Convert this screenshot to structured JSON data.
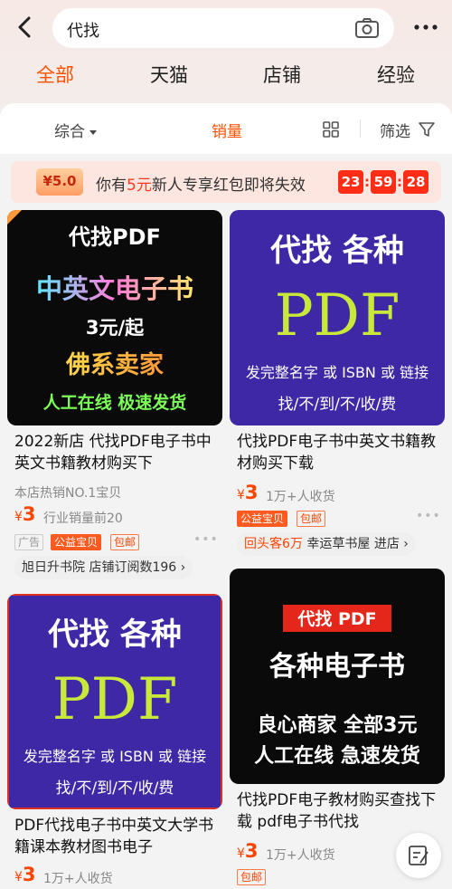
{
  "search": {
    "query": "代找"
  },
  "tabs": [
    "全部",
    "天猫",
    "店铺",
    "经验"
  ],
  "filters": {
    "sort": "综合",
    "sales": "销量",
    "filter": "筛选"
  },
  "promo": {
    "coupon": "¥5.0",
    "text_pre": "你有",
    "amount": "5元",
    "text_post": "新人专享红包即将失效",
    "hh": "23",
    "mm": "59",
    "ss": "28"
  },
  "products": [
    {
      "image": {
        "lines": [
          "代找PDF",
          "中英文电子书",
          "3元/起",
          "佛系卖家",
          "人工在线  极速发货"
        ]
      },
      "title": "2022新店 代找PDF电子书中英文书籍教材购买下",
      "subtitle": "本店热销NO.1宝贝",
      "price_symbol": "¥",
      "price": "3",
      "sales": "行业销量前20",
      "tags": [
        "广告",
        "公益宝贝",
        "包邮"
      ],
      "shop": "旭日升书院 店铺订阅数196"
    },
    {
      "image": {
        "lines": [
          "代找  各种",
          "PDF",
          "发完整名字 或 ISBN 或 链接",
          "找/不/到/不/收/费"
        ]
      },
      "title": "代找PDF电子书中英文书籍教材购买下载",
      "price_symbol": "¥",
      "price": "3",
      "sales": "1万+人收货",
      "tags": [
        "公益宝贝",
        "包邮"
      ],
      "shop_highlight": "回头客6万",
      "shop_name": "幸运草书屋",
      "shop_enter": "进店"
    },
    {
      "image": {
        "lines": [
          "代找  各种",
          "PDF",
          "发完整名字 或 ISBN 或 链接",
          "找/不/到/不/收/费"
        ]
      },
      "title": "PDF代找电子书中英文大学书籍课本教材图书电子",
      "price_symbol": "¥",
      "price": "3",
      "sales": "1万+人收货"
    },
    {
      "image": {
        "lines": [
          "代找 PDF",
          "各种电子书",
          "良心商家  全部3元",
          "人工在线  急速发货"
        ]
      },
      "title": "代找PDF电子教材购买查找下载 pdf电子书代找",
      "price_symbol": "¥",
      "price": "3",
      "sales": "1万+人收货",
      "tags": [
        "包邮"
      ]
    }
  ],
  "colors": {
    "accent": "#ff5000",
    "price": "#ff4400",
    "promo_bg": "#fde6e0",
    "image_purple": "#3f28a6"
  }
}
